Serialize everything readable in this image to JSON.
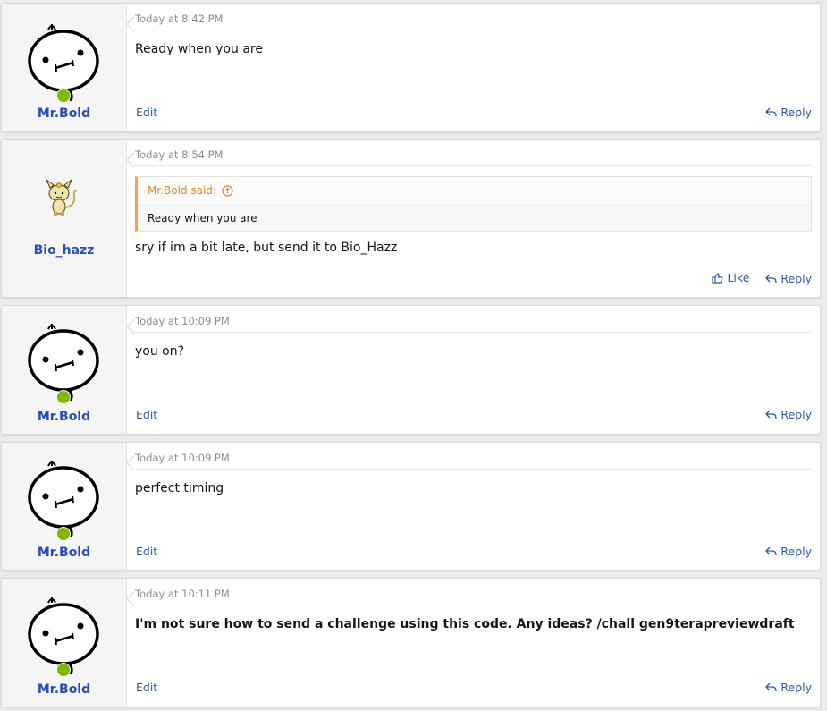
{
  "colors": {
    "accent": "#2a4db3",
    "link": "#2f5aa8",
    "quote_border": "#f1a44b",
    "online": "#7fb900"
  },
  "posts": [
    {
      "username": "Mr.Bold",
      "avatar": "doodle-face",
      "timestamp": "Today at 8:42 PM",
      "message": "Ready when you are",
      "edit_label": "Edit",
      "reply_label": "Reply"
    },
    {
      "username": "Bio_hazz",
      "avatar": "meowth-sprite",
      "timestamp": "Today at 8:54 PM",
      "quote": {
        "author_label": "Mr.Bold said:",
        "text": "Ready when you are"
      },
      "message": "sry if im a bit late, but send it to Bio_Hazz",
      "like_label": "Like",
      "reply_label": "Reply"
    },
    {
      "username": "Mr.Bold",
      "avatar": "doodle-face",
      "timestamp": "Today at 10:09 PM",
      "message": "you on?",
      "edit_label": "Edit",
      "reply_label": "Reply"
    },
    {
      "username": "Mr.Bold",
      "avatar": "doodle-face",
      "timestamp": "Today at 10:09 PM",
      "message": "perfect timing",
      "edit_label": "Edit",
      "reply_label": "Reply"
    },
    {
      "username": "Mr.Bold",
      "avatar": "doodle-face",
      "timestamp": "Today at 10:11 PM",
      "message": "I'm not sure how to send a challenge using this code. Any ideas? /chall gen9terapreviewdraft",
      "message_bold": true,
      "edit_label": "Edit",
      "reply_label": "Reply"
    }
  ]
}
